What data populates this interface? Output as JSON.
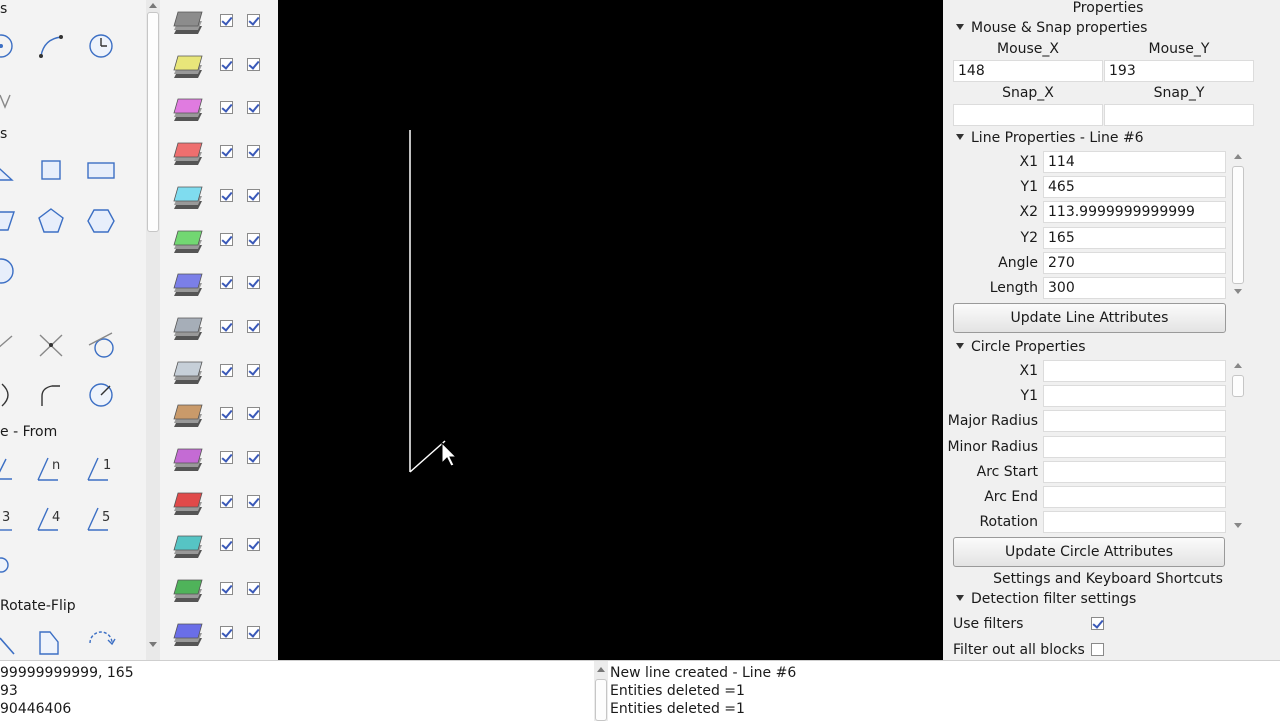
{
  "toolbox": {
    "sections": [
      {
        "label": "s"
      },
      {
        "label": "s"
      },
      {
        "label": "e - From"
      },
      {
        "label": "Rotate-Flip"
      }
    ],
    "tools": [
      {
        "icon": "circle-center-point-icon"
      },
      {
        "icon": "arc-three-point-icon"
      },
      {
        "icon": "circle-clock-icon"
      },
      {
        "icon": "triangle-icon"
      },
      {
        "icon": "square-icon"
      },
      {
        "icon": "rectangle-icon"
      },
      {
        "icon": "parallelogram-icon"
      },
      {
        "icon": "pentagon-icon"
      },
      {
        "icon": "hexagon-icon"
      },
      {
        "icon": "octagon-icon"
      },
      {
        "icon": "line-tangent-icon"
      },
      {
        "icon": "line-intersect-icon"
      },
      {
        "icon": "circle-tangent-icon"
      },
      {
        "icon": "arc-icon"
      },
      {
        "icon": "arc-fillet-icon"
      },
      {
        "icon": "circle-dimension-icon"
      },
      {
        "icon": "angle-n-icon"
      },
      {
        "icon": "angle-1-icon"
      },
      {
        "icon": "angle-3-icon"
      },
      {
        "icon": "angle-4-icon"
      },
      {
        "icon": "angle-5-icon"
      },
      {
        "icon": "small-circle-icon"
      },
      {
        "icon": "mirror-icon"
      },
      {
        "icon": "flip-icon"
      },
      {
        "icon": "rotate-icon"
      }
    ],
    "angle_labels": [
      "n",
      "1",
      "3",
      "4",
      "5"
    ]
  },
  "layers": [
    {
      "color": "#8c8c8c",
      "visible": true,
      "locked": true
    },
    {
      "color": "#e8e67a",
      "visible": true,
      "locked": true
    },
    {
      "color": "#e07be0",
      "visible": true,
      "locked": true
    },
    {
      "color": "#ee6f6f",
      "visible": true,
      "locked": true
    },
    {
      "color": "#7fdcef",
      "visible": true,
      "locked": true
    },
    {
      "color": "#72d772",
      "visible": true,
      "locked": true
    },
    {
      "color": "#7b7fe8",
      "visible": true,
      "locked": true
    },
    {
      "color": "#a6aeb8",
      "visible": true,
      "locked": true
    },
    {
      "color": "#c6cfd8",
      "visible": true,
      "locked": true
    },
    {
      "color": "#c99a6a",
      "visible": true,
      "locked": true
    },
    {
      "color": "#c46bd4",
      "visible": true,
      "locked": true
    },
    {
      "color": "#e04a4a",
      "visible": true,
      "locked": true
    },
    {
      "color": "#56c4c4",
      "visible": true,
      "locked": true
    },
    {
      "color": "#4fb35a",
      "visible": true,
      "locked": true
    },
    {
      "color": "#6a6ee8",
      "visible": true,
      "locked": true
    }
  ],
  "canvas": {
    "background": "#000000",
    "line_color": "#ffffff"
  },
  "properties": {
    "title": "Properties",
    "mouse_snap": {
      "header": "Mouse & Snap properties",
      "mouse_x_label": "Mouse_X",
      "mouse_y_label": "Mouse_Y",
      "mouse_x": "148",
      "mouse_y": "193",
      "snap_x_label": "Snap_X",
      "snap_y_label": "Snap_Y",
      "snap_x": "",
      "snap_y": ""
    },
    "line": {
      "header": "Line Properties - Line #6",
      "fields": [
        {
          "label": "X1",
          "value": "114"
        },
        {
          "label": "Y1",
          "value": "465"
        },
        {
          "label": "X2",
          "value": "113.9999999999999"
        },
        {
          "label": "Y2",
          "value": "165"
        },
        {
          "label": "Angle",
          "value": "270"
        },
        {
          "label": "Length",
          "value": "300"
        }
      ],
      "button": "Update Line Attributes"
    },
    "circle": {
      "header": "Circle Properties",
      "fields": [
        {
          "label": "X1",
          "value": ""
        },
        {
          "label": "Y1",
          "value": ""
        },
        {
          "label": "Major Radius",
          "value": ""
        },
        {
          "label": "Minor Radius",
          "value": ""
        },
        {
          "label": "Arc Start",
          "value": ""
        },
        {
          "label": "Arc End",
          "value": ""
        },
        {
          "label": "Rotation",
          "value": ""
        }
      ],
      "button": "Update Circle Attributes"
    },
    "settings_title": "Settings and Keyboard Shortcuts",
    "detection": {
      "header": "Detection filter settings",
      "use_filters_label": "Use filters",
      "use_filters": true,
      "filter_blocks_label": "Filter out all blocks"
    }
  },
  "console_left": [
    "99999999999, 165",
    "93",
    "90446406"
  ],
  "console_right": [
    "New line created - Line #6",
    "Entities deleted =1",
    "Entities deleted =1"
  ]
}
